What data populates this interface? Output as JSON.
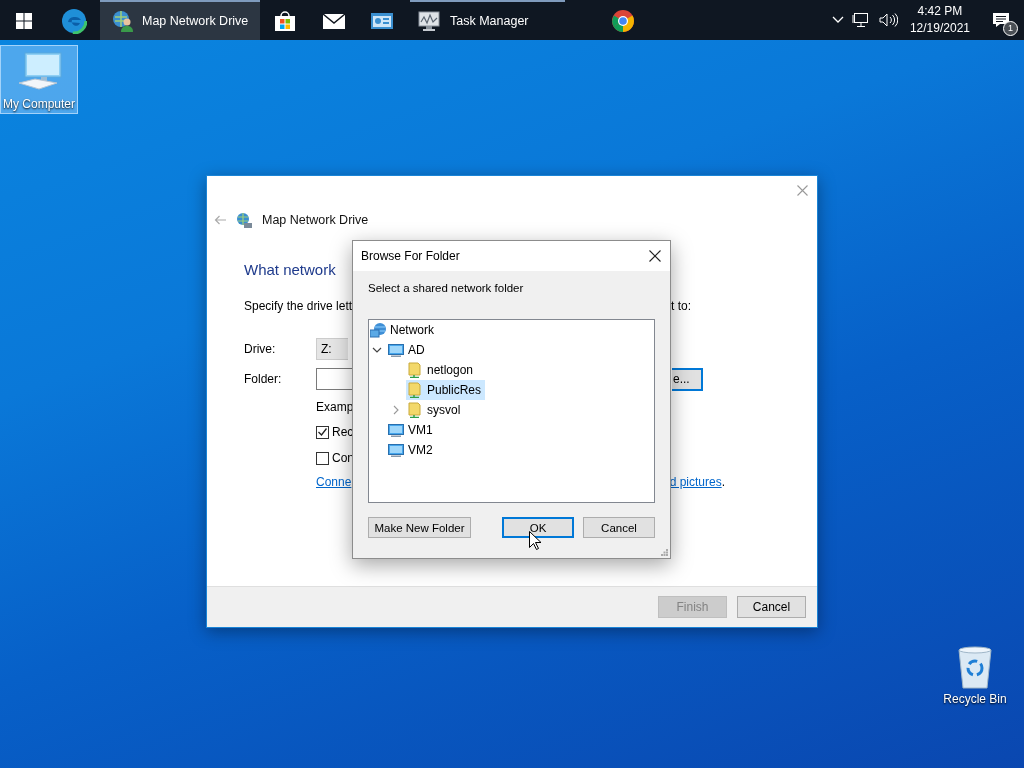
{
  "taskbar": {
    "items": [
      {
        "kind": "start",
        "running": false,
        "selected": false
      },
      {
        "kind": "browser",
        "running": false,
        "selected": false
      },
      {
        "kind": "drive",
        "label": "Map Network Drive",
        "running": true,
        "selected": true
      },
      {
        "kind": "store",
        "running": false,
        "selected": false
      },
      {
        "kind": "mail",
        "running": false,
        "selected": false
      },
      {
        "kind": "panel",
        "running": false,
        "selected": false
      },
      {
        "kind": "monitor",
        "label": "Task Manager",
        "running": true,
        "selected": false
      },
      {
        "kind": "chrome",
        "running": false,
        "selected": false
      }
    ],
    "tray": {
      "time": "4:42 PM",
      "date": "12/19/2021",
      "notification_count": "1"
    }
  },
  "desktop_icons": [
    {
      "kind": "computer",
      "label": "My Computer",
      "selected": true
    },
    {
      "kind": "recycle",
      "label": "Recycle Bin",
      "selected": false
    }
  ],
  "wizard": {
    "title": "Map Network Drive",
    "heading": "What network",
    "instruction_left": "Specify the drive lett",
    "instruction_right": "t to:",
    "drive_label": "Drive:",
    "drive_value": "Z:",
    "folder_label": "Folder:",
    "browse_button": "e...",
    "example": "Examp",
    "options": [
      {
        "label": "Rec",
        "checked": true
      },
      {
        "label": "Con",
        "checked": false
      }
    ],
    "link_left": "Conne",
    "link_right": "d pictures",
    "link_tail": ".",
    "buttons": [
      {
        "label": "Finish",
        "disabled": true
      },
      {
        "label": "Cancel",
        "disabled": false
      }
    ]
  },
  "dialog": {
    "title": "Browse For Folder",
    "prompt": "Select a shared network folder",
    "tree": [
      {
        "kind": "network",
        "label": "Network",
        "selected": false,
        "children": [
          {
            "kind": "computer",
            "label": "AD",
            "selected": false,
            "expanded": true,
            "children": [
              {
                "kind": "share",
                "label": "netlogon",
                "selected": false
              },
              {
                "kind": "share",
                "label": "PublicRes",
                "selected": true
              },
              {
                "kind": "share",
                "label": "sysvol",
                "selected": false,
                "expanded": false
              }
            ]
          },
          {
            "kind": "computer",
            "label": "VM1",
            "selected": false
          },
          {
            "kind": "computer",
            "label": "VM2",
            "selected": false
          }
        ]
      }
    ],
    "buttons": [
      {
        "label": "Make New Folder",
        "focused": false
      },
      {
        "label": "OK",
        "focused": true
      },
      {
        "label": "Cancel",
        "focused": false
      }
    ]
  }
}
